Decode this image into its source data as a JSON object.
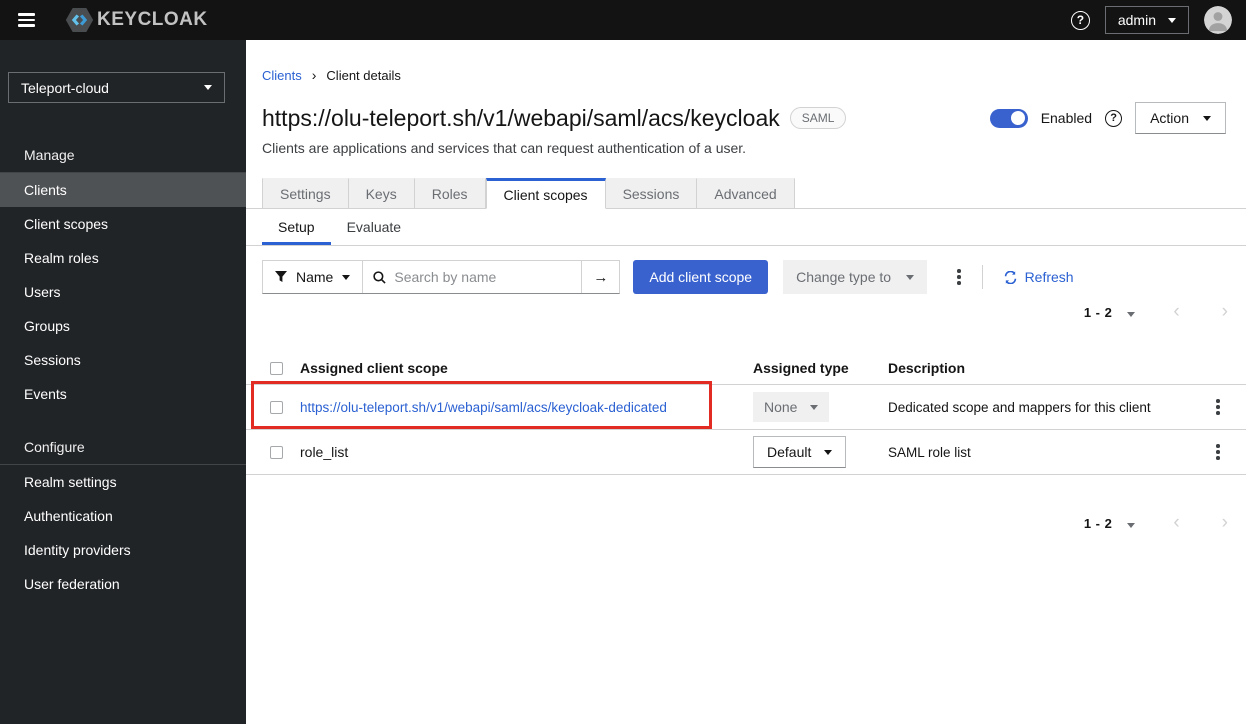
{
  "colors": {
    "accent_blue": "#3a62cf",
    "link_blue": "#2b61d2",
    "annotation_red": "#e12b23",
    "masthead_bg": "#131313",
    "sidebar_bg": "#212427",
    "sidebar_active_bg": "#4f5255"
  },
  "header": {
    "product": "KEYCLOAK",
    "help_glyph": "?",
    "user": "admin"
  },
  "sidebar": {
    "realm": "Teleport-cloud",
    "sections": [
      {
        "title": "Manage",
        "items": [
          {
            "label": "Clients"
          },
          {
            "label": "Client scopes"
          },
          {
            "label": "Realm roles"
          },
          {
            "label": "Users"
          },
          {
            "label": "Groups"
          },
          {
            "label": "Sessions"
          },
          {
            "label": "Events"
          }
        ]
      },
      {
        "title": "Configure",
        "items": [
          {
            "label": "Realm settings"
          },
          {
            "label": "Authentication"
          },
          {
            "label": "Identity providers"
          },
          {
            "label": "User federation"
          }
        ]
      }
    ]
  },
  "breadcrumb": {
    "parent": "Clients",
    "current": "Client details"
  },
  "page": {
    "title": "https://olu-teleport.sh/v1/webapi/saml/acs/keycloak",
    "protocol_badge": "SAML",
    "description": "Clients are applications and services that can request authentication of a user.",
    "enabled_label": "Enabled",
    "help_glyph": "?",
    "action_dropdown": "Action"
  },
  "tabs": {
    "active": "Client scopes",
    "items": [
      {
        "label": "Settings"
      },
      {
        "label": "Keys"
      },
      {
        "label": "Roles"
      },
      {
        "label": "Client scopes"
      },
      {
        "label": "Sessions"
      },
      {
        "label": "Advanced"
      }
    ]
  },
  "subtabs": {
    "active": "Setup",
    "items": [
      {
        "label": "Setup"
      },
      {
        "label": "Evaluate"
      }
    ]
  },
  "toolbar": {
    "filter_label": "Name",
    "search_placeholder": "Search by name",
    "search_submit_glyph": "→",
    "add_button_label": "Add client scope",
    "change_type_label": "Change type to",
    "refresh_label": "Refresh"
  },
  "pagination": {
    "range_label": "1 - 2",
    "prev_glyph": "‹",
    "next_glyph": "›"
  },
  "table": {
    "columns": {
      "scope": "Assigned client scope",
      "type": "Assigned type",
      "description": "Description"
    },
    "rows": [
      {
        "scope": "https://olu-teleport.sh/v1/webapi/saml/acs/keycloak-dedicated",
        "assigned_type": "None",
        "description": "Dedicated scope and mappers for this client"
      },
      {
        "scope": "role_list",
        "assigned_type": "Default",
        "description": "SAML role list"
      }
    ]
  }
}
